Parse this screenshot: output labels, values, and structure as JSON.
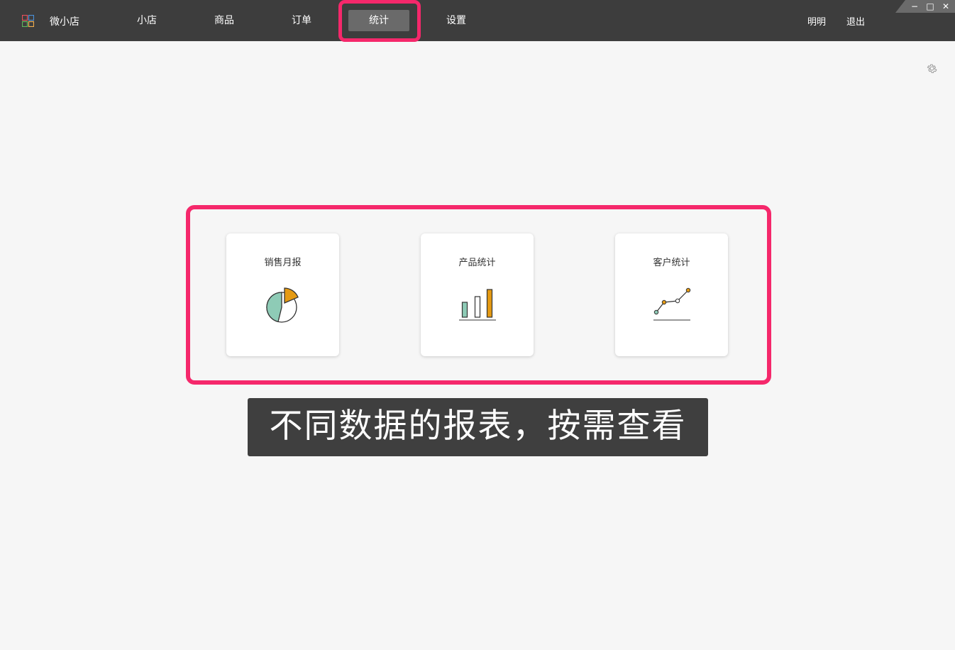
{
  "header": {
    "app_name": "微小店",
    "nav": [
      "小店",
      "商品",
      "订单",
      "统计",
      "设置"
    ],
    "active_nav": "统计",
    "user_name": "明明",
    "logout_label": "退出"
  },
  "window_controls": {
    "minimize": "−",
    "maximize": "□",
    "close": "✕"
  },
  "cards": [
    {
      "title": "销售月报",
      "icon": "pie-chart-icon"
    },
    {
      "title": "产品统计",
      "icon": "bar-chart-icon"
    },
    {
      "title": "客户统计",
      "icon": "line-chart-icon"
    }
  ],
  "caption": "不同数据的报表，按需查看",
  "colors": {
    "topbar": "#3d3d3d",
    "highlight": "#f5286b",
    "accent_orange": "#e59a12",
    "accent_green": "#8ecbb6"
  }
}
